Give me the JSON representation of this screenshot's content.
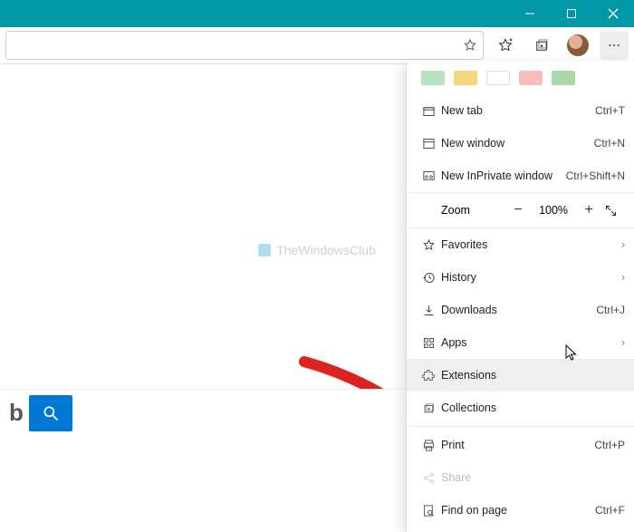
{
  "window": {
    "title": ""
  },
  "toolbar": {
    "url_value": ""
  },
  "swatches": [
    "#b8e3c0",
    "#f4d77a",
    "#ffffff",
    "#f6bdbd",
    "#a9d9a6"
  ],
  "menu": {
    "new_tab": "New tab",
    "new_tab_sc": "Ctrl+T",
    "new_window": "New window",
    "new_window_sc": "Ctrl+N",
    "inprivate": "New InPrivate window",
    "inprivate_sc": "Ctrl+Shift+N",
    "zoom_label": "Zoom",
    "zoom_value": "100%",
    "favorites": "Favorites",
    "history": "History",
    "downloads": "Downloads",
    "downloads_sc": "Ctrl+J",
    "apps": "Apps",
    "extensions": "Extensions",
    "collections": "Collections",
    "print": "Print",
    "print_sc": "Ctrl+P",
    "share": "Share",
    "find": "Find on page",
    "find_sc": "Ctrl+F"
  },
  "watermark": "TheWindowsClub",
  "bottom": {
    "bing": "b"
  }
}
